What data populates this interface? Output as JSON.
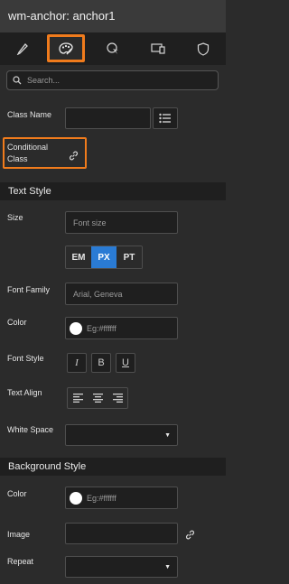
{
  "window": {
    "title": "wm-anchor: anchor1"
  },
  "tabs": [
    {
      "name": "pencil-icon"
    },
    {
      "name": "palette-icon",
      "active": true
    },
    {
      "name": "cursor-click-icon"
    },
    {
      "name": "devices-icon"
    },
    {
      "name": "shield-icon"
    }
  ],
  "search": {
    "placeholder": "Search..."
  },
  "props": {
    "class_name_label": "Class Name",
    "conditional_class_label_1": "Conditional",
    "conditional_class_label_2": "Class"
  },
  "text_style": {
    "header": "Text Style",
    "size_label": "Size",
    "size_placeholder": "Font size",
    "units": [
      "EM",
      "PX",
      "PT"
    ],
    "selected_unit": "PX",
    "font_family_label": "Font Family",
    "font_family_placeholder": "Arial, Geneva",
    "color_label": "Color",
    "color_placeholder": "Eg:#ffffff",
    "font_style_label": "Font Style",
    "font_style_buttons": [
      "I",
      "B",
      "U"
    ],
    "text_align_label": "Text Align",
    "white_space_label": "White Space",
    "white_space_value": ""
  },
  "background_style": {
    "header": "Background Style",
    "color_label": "Color",
    "color_placeholder": "Eg:#ffffff",
    "image_label": "Image",
    "repeat_label": "Repeat",
    "repeat_value": ""
  },
  "colors": {
    "accent": "#f07b1c",
    "selected_unit": "#2a7bd4"
  }
}
